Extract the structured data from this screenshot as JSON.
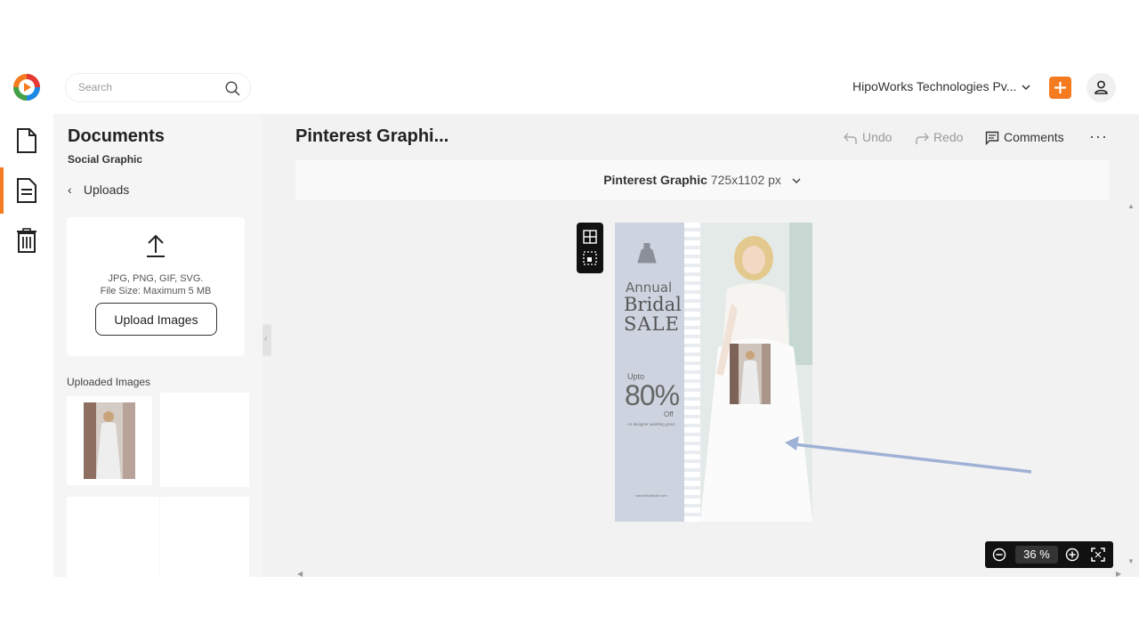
{
  "search": {
    "placeholder": "Search"
  },
  "header": {
    "org_name": "HipoWorks Technologies Pv..."
  },
  "panel": {
    "title": "Documents",
    "subtitle": "Social Graphic",
    "back_label": "Uploads",
    "upload": {
      "formats": "JPG, PNG, GIF, SVG.",
      "size_limit": "File Size: Maximum 5 MB",
      "button_label": "Upload Images"
    },
    "uploaded_label": "Uploaded Images"
  },
  "editor": {
    "title": "Pinterest Graphi...",
    "undo_label": "Undo",
    "redo_label": "Redo",
    "comments_label": "Comments",
    "more_label": "···",
    "format_name": "Pinterest Graphic",
    "format_size": "725x1102 px"
  },
  "design": {
    "line1": "Annual",
    "line2": "Bridal",
    "line3": "SALE",
    "upto": "Upto",
    "discount": "80%",
    "off": "Off",
    "small_text": "on designer wedding gown",
    "url": "www.bridalsale.com"
  },
  "zoom": {
    "value": "36",
    "unit": "%"
  },
  "colors": {
    "accent": "#f47b20",
    "toolbar": "#111111",
    "panel_bg": "#f5f5f5"
  }
}
